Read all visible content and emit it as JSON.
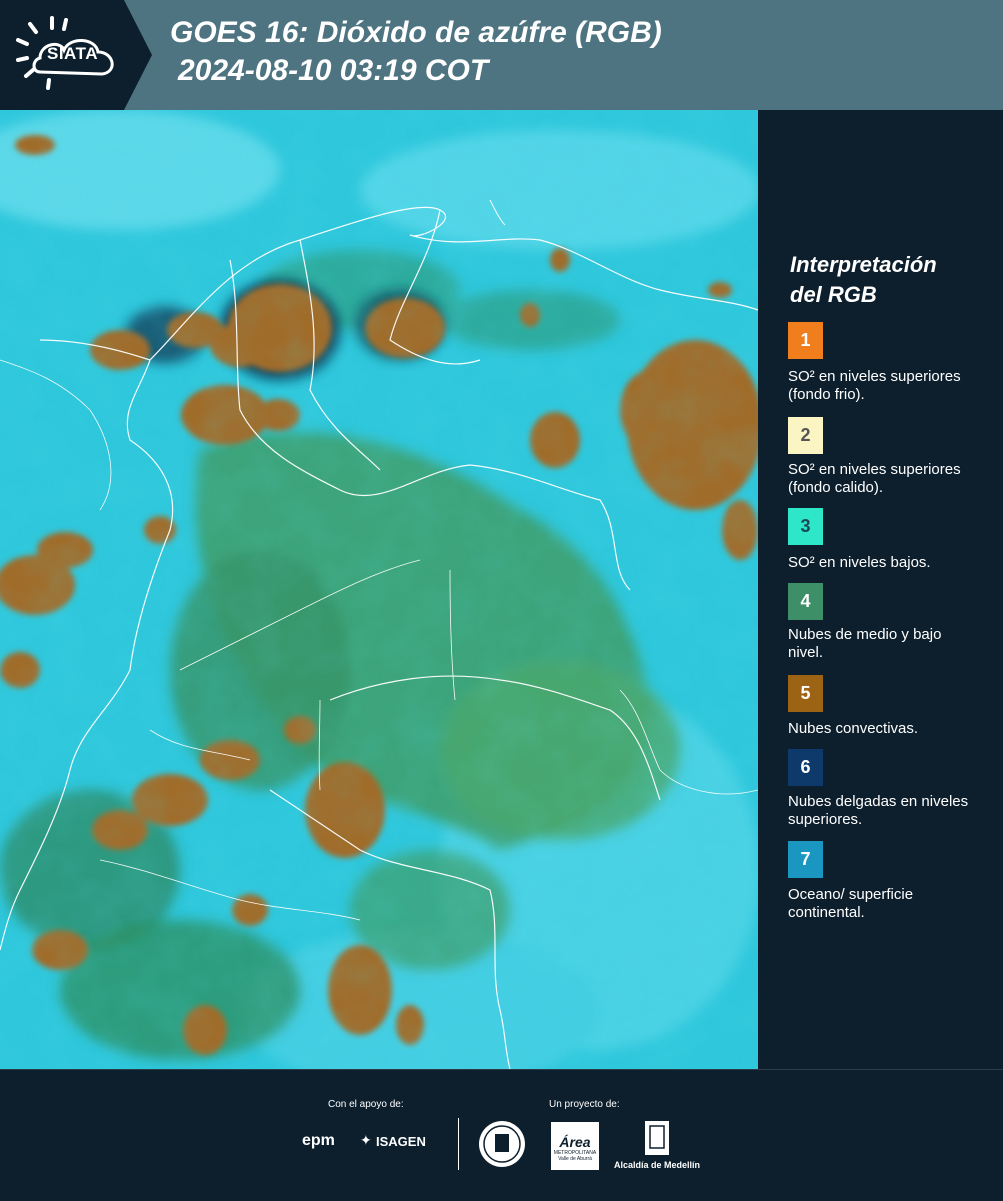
{
  "header": {
    "logo": "SIATA",
    "title_line1": "GOES 16: Dióxido de azúfre (RGB)",
    "title_line2": "2024-08-10 03:19 COT"
  },
  "legend": {
    "title_line1": "Interpretación",
    "title_line2": "del RGB",
    "items": [
      {
        "number": "1",
        "color": "#f07e1c",
        "text_color": "#ffffff",
        "label": "SO² en niveles superiores (fondo frio)."
      },
      {
        "number": "2",
        "color": "#fbf5c4",
        "text_color": "#555555",
        "label": "SO² en niveles superiores (fondo calido)."
      },
      {
        "number": "3",
        "color": "#2ee6c8",
        "text_color": "#1a4a55",
        "label": "SO² en niveles bajos."
      },
      {
        "number": "4",
        "color": "#3c8f66",
        "text_color": "#ffffff",
        "label": "Nubes de medio y bajo nivel."
      },
      {
        "number": "5",
        "color": "#9c6314",
        "text_color": "#ffffff",
        "label": "Nubes convectivas."
      },
      {
        "number": "6",
        "color": "#0e3a6b",
        "text_color": "#ffffff",
        "label": "Nubes delgadas en niveles superiores."
      },
      {
        "number": "7",
        "color": "#1a97c0",
        "text_color": "#ffffff",
        "label": "Oceano/ superficie continental."
      }
    ]
  },
  "footer": {
    "support_label": "Con el apoyo de:",
    "project_label": "Un proyecto de:",
    "logo_epm": "epm",
    "logo_isagen": "ISAGEN",
    "logo_area": "Área",
    "logo_area_sub": "METROPOLITANA",
    "logo_area_sub2": "Valle de Aburrá",
    "logo_alcaldia": "Alcaldía de Medellín"
  }
}
